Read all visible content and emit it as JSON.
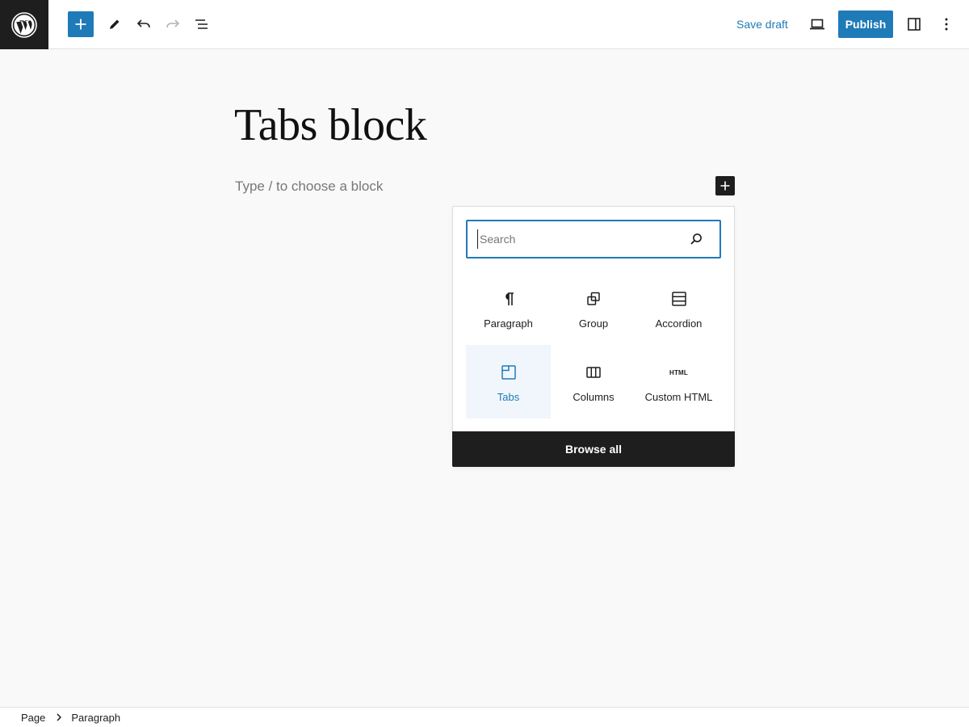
{
  "colors": {
    "accent": "#1f7ab8",
    "dark": "#1e1e1e",
    "canvas": "#f9f9f9"
  },
  "toolbar": {
    "logo_icon": "wordpress-logo-icon",
    "inserter_icon": "plus-icon",
    "tools_icon": "pencil-icon",
    "undo_icon": "undo-icon",
    "redo_icon": "redo-icon",
    "list_view_icon": "list-view-icon",
    "save_draft_label": "Save draft",
    "preview_icon": "laptop-icon",
    "publish_label": "Publish",
    "settings_icon": "sidebar-icon",
    "options_icon": "vertical-ellipsis-icon"
  },
  "editor": {
    "title": "Tabs block",
    "block_placeholder": "Type / to choose a block",
    "inline_inserter_icon": "plus-icon"
  },
  "quick_inserter": {
    "search_placeholder": "Search",
    "search_value": "",
    "blocks": [
      {
        "label": "Paragraph",
        "icon": "paragraph-icon",
        "selected": false
      },
      {
        "label": "Group",
        "icon": "group-icon",
        "selected": false
      },
      {
        "label": "Accordion",
        "icon": "accordion-icon",
        "selected": false
      },
      {
        "label": "Tabs",
        "icon": "tabs-icon",
        "selected": true
      },
      {
        "label": "Columns",
        "icon": "columns-icon",
        "selected": false
      },
      {
        "label": "Custom HTML",
        "icon": "html-icon",
        "selected": false
      }
    ],
    "html_icon_text": "HTML",
    "browse_all_label": "Browse all"
  },
  "breadcrumb": {
    "items": [
      "Page",
      "Paragraph"
    ]
  }
}
